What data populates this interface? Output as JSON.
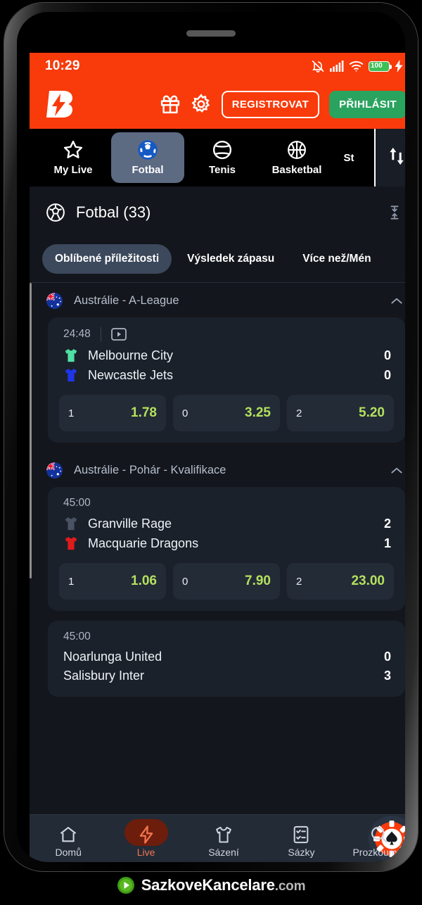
{
  "status_bar": {
    "time": "10:29",
    "battery_level": "100",
    "icons": [
      "bell-muted-icon",
      "signal-bars-icon",
      "wifi-icon",
      "battery-icon",
      "charging-bolt-icon"
    ]
  },
  "header": {
    "logo": "b-bolt-logo",
    "gift_icon": "gift-icon",
    "settings_icon": "gear-icon",
    "register_label": "REGISTROVAT",
    "login_label": "PŘIHLÁSIT",
    "bg_color": "#f93a0a",
    "login_color": "#2aa35f"
  },
  "sport_tabs": {
    "items": [
      {
        "label": "My Live",
        "icon": "star-icon",
        "active": false
      },
      {
        "label": "Fotbal",
        "icon": "football-icon",
        "active": true
      },
      {
        "label": "Tenis",
        "icon": "tennis-ball-icon",
        "active": false
      },
      {
        "label": "Basketbal",
        "icon": "basketball-icon",
        "active": false
      },
      {
        "label": "St",
        "icon": "table-tennis-icon",
        "active": false
      }
    ],
    "sort_icon": "sort-up-down-icon",
    "active_bg": "#5c6a82"
  },
  "section": {
    "icon": "football-icon",
    "title": "Fotbal (33)",
    "collapse_icon": "collapse-all-icon"
  },
  "market_chips": {
    "items": [
      {
        "label": "Oblíbené příležitosti",
        "active": true
      },
      {
        "label": "Výsledek zápasu",
        "active": false
      },
      {
        "label": "Více než/Mén",
        "active": false
      }
    ],
    "active_bg": "#3c485c"
  },
  "leagues": [
    {
      "flag": "australia-flag-icon",
      "name": "Austrálie - A-League",
      "chevron": "chevron-up-icon",
      "matches": [
        {
          "time": "24:48",
          "has_stream": true,
          "stream_icon": "video-stream-icon",
          "home": {
            "name": "Melbourne City",
            "score": "0",
            "shirt_color": "#4fe0a5",
            "has_shirt": true
          },
          "away": {
            "name": "Newcastle Jets",
            "score": "0",
            "shirt_color": "#1f35e8",
            "has_shirt": true
          },
          "odds": [
            {
              "label": "1",
              "value": "1.78"
            },
            {
              "label": "0",
              "value": "3.25"
            },
            {
              "label": "2",
              "value": "5.20"
            }
          ]
        }
      ]
    },
    {
      "flag": "australia-flag-icon",
      "name": "Austrálie - Pohár - Kvalifikace",
      "chevron": "chevron-up-icon",
      "matches": [
        {
          "time": "45:00",
          "has_stream": false,
          "stream_icon": "",
          "home": {
            "name": "Granville Rage",
            "score": "2",
            "shirt_color": "#4a5363",
            "has_shirt": true
          },
          "away": {
            "name": "Macquarie Dragons",
            "score": "1",
            "shirt_color": "#e01b1b",
            "has_shirt": true
          },
          "odds": [
            {
              "label": "1",
              "value": "1.06"
            },
            {
              "label": "0",
              "value": "7.90"
            },
            {
              "label": "2",
              "value": "23.00"
            }
          ]
        },
        {
          "time": "45:00",
          "has_stream": false,
          "stream_icon": "",
          "home": {
            "name": "Noarlunga United",
            "score": "0",
            "shirt_color": "",
            "has_shirt": false
          },
          "away": {
            "name": "Salisbury Inter",
            "score": "3",
            "shirt_color": "",
            "has_shirt": false
          },
          "odds": []
        }
      ]
    }
  ],
  "bottom_nav": {
    "items": [
      {
        "label": "Domů",
        "icon": "home-icon",
        "active": false
      },
      {
        "label": "Live",
        "icon": "lightning-bolt-icon",
        "active": true
      },
      {
        "label": "Sázení",
        "icon": "shirt-icon",
        "active": false
      },
      {
        "label": "Sázky",
        "icon": "bet-slip-icon",
        "active": false
      },
      {
        "label": "Prozkoumat",
        "icon": "search-icon",
        "active": false
      }
    ],
    "casino_icon": "casino-chip-icon",
    "active_color": "#f4754f"
  },
  "watermark": {
    "play_icon": "play-circle-icon",
    "name": "SazkoveKancelare",
    "tld": ".com"
  },
  "odds_value_color": "#b4e05e"
}
